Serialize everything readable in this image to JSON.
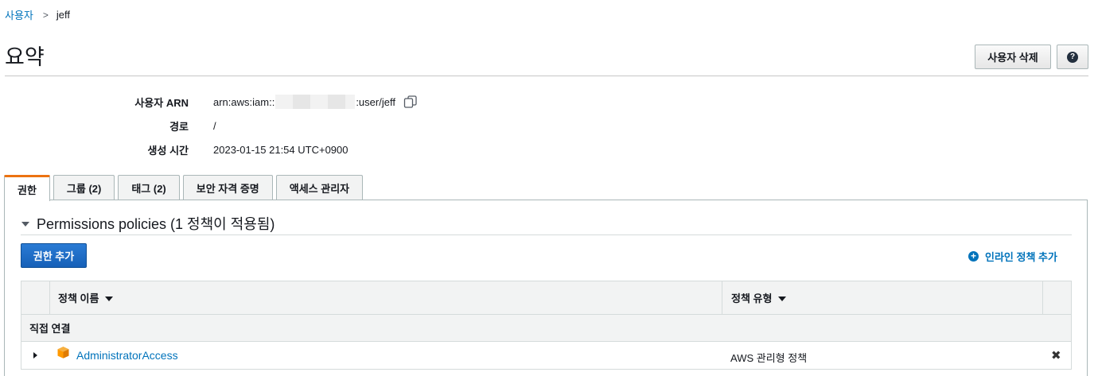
{
  "breadcrumb": {
    "parent": "사용자",
    "separator": ">",
    "current": "jeff"
  },
  "page": {
    "title": "요약",
    "delete_button": "사용자 삭제",
    "help_glyph": "?"
  },
  "summary": {
    "arn_label": "사용자 ARN",
    "arn_prefix": "arn:aws:iam::",
    "arn_suffix": ":user/jeff",
    "path_label": "경로",
    "path_value": "/",
    "created_label": "생성 시간",
    "created_value": "2023-01-15 21:54 UTC+0900"
  },
  "tabs": [
    {
      "label": "권한",
      "active": true
    },
    {
      "label": "그룹 (2)",
      "active": false
    },
    {
      "label": "태그 (2)",
      "active": false
    },
    {
      "label": "보안 자격 증명",
      "active": false
    },
    {
      "label": "액세스 관리자",
      "active": false
    }
  ],
  "permissions": {
    "section_title": "Permissions policies (1 정책이 적용됨)",
    "add_button": "권한 추가",
    "inline_add": "인라인 정책 추가",
    "inline_add_glyph": "+",
    "columns": {
      "name": "정책 이름",
      "type": "정책 유형"
    },
    "group_label": "직접 연결",
    "rows": [
      {
        "name": "AdministratorAccess",
        "type": "AWS 관리형 정책",
        "remove_glyph": "✖"
      }
    ]
  },
  "colors": {
    "link": "#0073bb",
    "primary_button": "#1660b8",
    "tab_accent": "#ec7211",
    "policy_icon": "#f90"
  }
}
